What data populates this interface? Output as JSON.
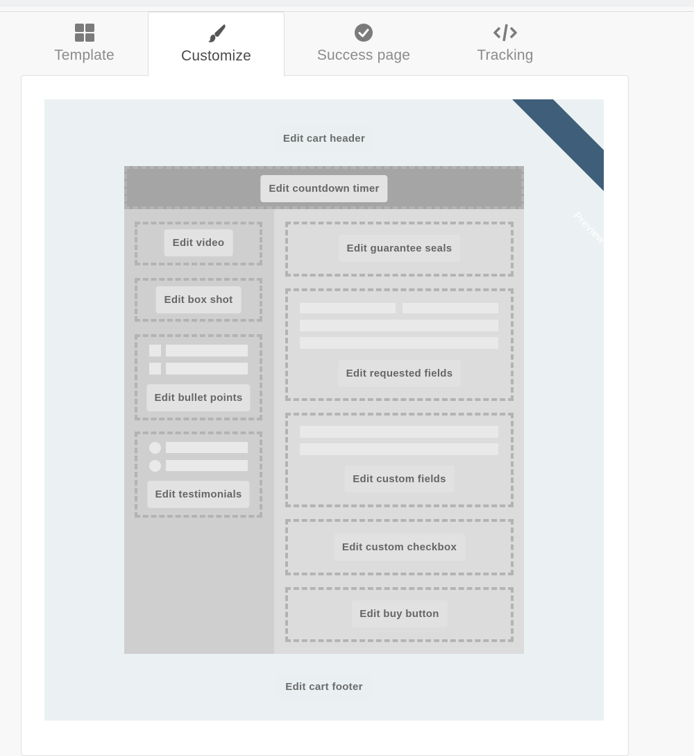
{
  "tabs": [
    {
      "label": "Template",
      "icon": "grid-icon",
      "active": false
    },
    {
      "label": "Customize",
      "icon": "paintbrush-icon",
      "active": true
    },
    {
      "label": "Success page",
      "icon": "check-circle-icon",
      "active": false
    },
    {
      "label": "Tracking",
      "icon": "code-icon",
      "active": false
    }
  ],
  "preview": {
    "ribbon_label": "Preview",
    "ribbon_color": "#3e5e79",
    "header_button": "Edit cart header",
    "footer_button": "Edit cart footer",
    "countdown_button": "Edit countdown timer",
    "left_column": [
      {
        "label": "Edit video"
      },
      {
        "label": "Edit box shot"
      },
      {
        "label": "Edit bullet points"
      },
      {
        "label": "Edit testimonials"
      }
    ],
    "right_column": [
      {
        "label": "Edit guarantee seals"
      },
      {
        "label": "Edit requested fields"
      },
      {
        "label": "Edit custom fields"
      },
      {
        "label": "Edit custom checkbox"
      },
      {
        "label": "Edit buy button"
      }
    ]
  }
}
